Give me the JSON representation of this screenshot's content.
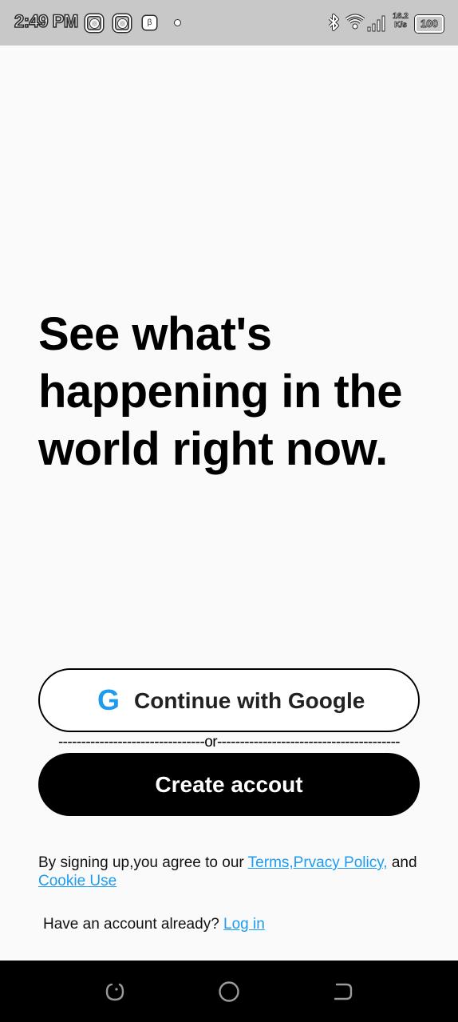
{
  "status_bar": {
    "time": "2:49 PM",
    "app_glyph": "β",
    "speed_value": "16.2",
    "speed_unit": "K/s",
    "battery": "100"
  },
  "main": {
    "headline_lines": [
      "See what's",
      "happening in the",
      "world right now."
    ]
  },
  "buttons": {
    "google_icon_letter": "G",
    "google_label": "Continue with Google",
    "create_label": "Create accout"
  },
  "divider": {
    "left": "--------------------------------",
    "text": "or",
    "right": "----------------------------------------"
  },
  "terms": {
    "prefix": "By signing up,you agree to our ",
    "terms_link": "Terms,Prvacy Policy,",
    "middle": " and",
    "cookie_link": "Cookie Use"
  },
  "login": {
    "prompt": "Have an account already? ",
    "link": "Log in"
  },
  "colors": {
    "accent": "#1d9bf0",
    "status_bar_bg": "#c8c8c8",
    "page_bg": "#fafafa",
    "nav_bar_bg": "#000000"
  },
  "icons": {
    "status": [
      "instagram-icon",
      "instagram-icon",
      "app-notification-icon",
      "dot-icon",
      "bluetooth-icon",
      "wifi-icon",
      "signal-icon",
      "battery-icon"
    ],
    "nav": [
      "recents-icon",
      "home-icon",
      "back-icon"
    ],
    "google": "google-icon"
  }
}
